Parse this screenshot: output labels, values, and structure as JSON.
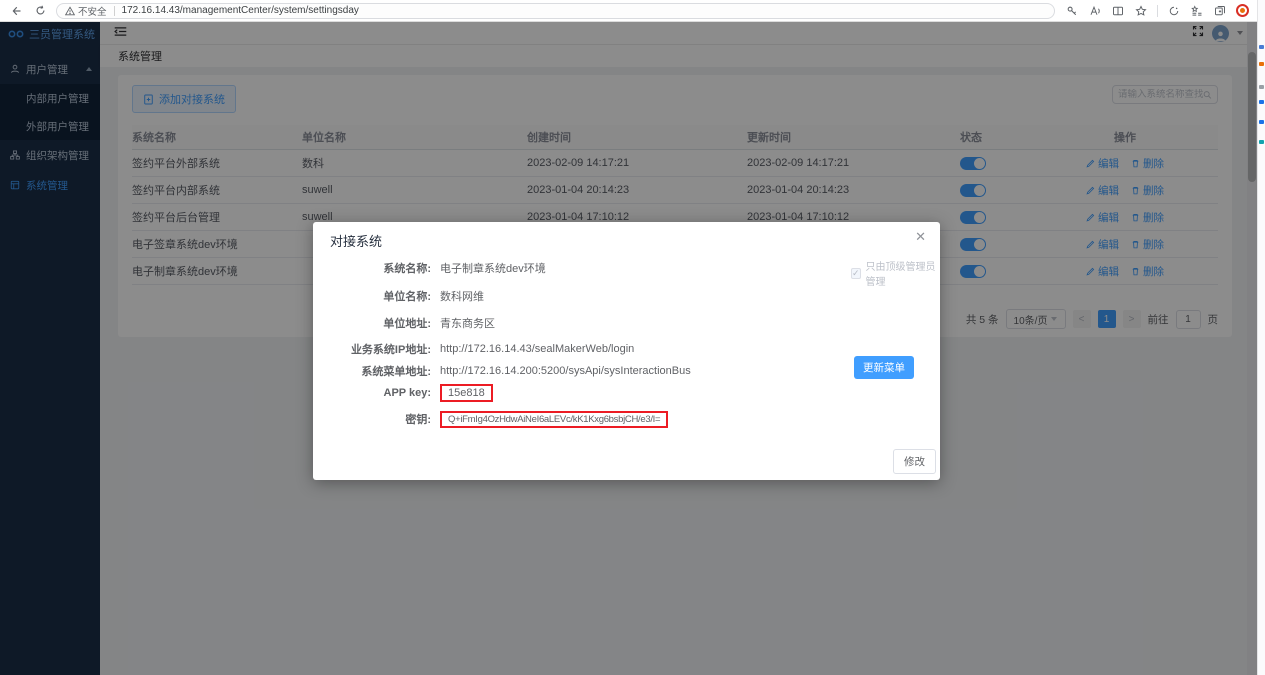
{
  "browser": {
    "security_label": "不安全",
    "url": "172.16.14.43/managementCenter/system/settingsday"
  },
  "app": {
    "logo_title": "三员管理系统",
    "breadcrumb": "系统管理",
    "sidebar": {
      "items": [
        {
          "label": "用户管理"
        },
        {
          "label": "内部用户管理"
        },
        {
          "label": "外部用户管理"
        },
        {
          "label": "组织架构管理"
        },
        {
          "label": "系统管理"
        }
      ]
    }
  },
  "toolbar": {
    "add_button": "添加对接系统",
    "search_placeholder": "请输入系统名称查找"
  },
  "table": {
    "headers": [
      "系统名称",
      "单位名称",
      "创建时间",
      "更新时间",
      "状态",
      "操作"
    ],
    "edit_label": "编辑",
    "delete_label": "删除",
    "rows": [
      {
        "name": "签约平台外部系统",
        "org": "数科",
        "created": "2023-02-09 14:17:21",
        "updated": "2023-02-09 14:17:21",
        "status_on": true
      },
      {
        "name": "签约平台内部系统",
        "org": "suwell",
        "created": "2023-01-04 20:14:23",
        "updated": "2023-01-04 20:14:23",
        "status_on": true
      },
      {
        "name": "签约平台后台管理",
        "org": "suwell",
        "created": "2023-01-04 17:10:12",
        "updated": "2023-01-04 17:10:12",
        "status_on": true
      },
      {
        "name": "电子签章系统dev环境",
        "org": "",
        "created": "",
        "updated": "",
        "status_on": true
      },
      {
        "name": "电子制章系统dev环境",
        "org": "",
        "created": "",
        "updated": "",
        "status_on": true
      }
    ]
  },
  "pagination": {
    "total": "共 5 条",
    "page_size": "10条/页",
    "prev": "<",
    "current_page": "1",
    "next": ">",
    "goto_label": "前往",
    "goto_value": "1",
    "page_label": "页"
  },
  "modal": {
    "title": "对接系统",
    "admin_checkbox": "只由顶级管理员管理",
    "fields": [
      {
        "label": "系统名称:",
        "value": "电子制章系统dev环境"
      },
      {
        "label": "单位名称:",
        "value": "数科网维"
      },
      {
        "label": "单位地址:",
        "value": "青东商务区"
      },
      {
        "label": "业务系统IP地址:",
        "value": "http://172.16.14.43/sealMakerWeb/login"
      },
      {
        "label": "系统菜单地址:",
        "value": "http://172.16.14.200:5200/sysApi/sysInteractionBus"
      },
      {
        "label": "APP key:",
        "value": "15e818",
        "highlighted": true
      },
      {
        "label": "密钥:",
        "value": "Q+iFmIg4OzHdwAiNeI6aLEVc/kK1Kxg6bsbjCH/e3/I=",
        "highlighted": true
      }
    ],
    "update_menu_button": "更新菜单",
    "modify_button": "修改",
    "close_glyph": "✕"
  },
  "colors": {
    "accent": "#409eff",
    "highlight_red": "#ec1c24",
    "sidebar_bg": "#1b2e47",
    "toggle_on": "#409eff"
  }
}
